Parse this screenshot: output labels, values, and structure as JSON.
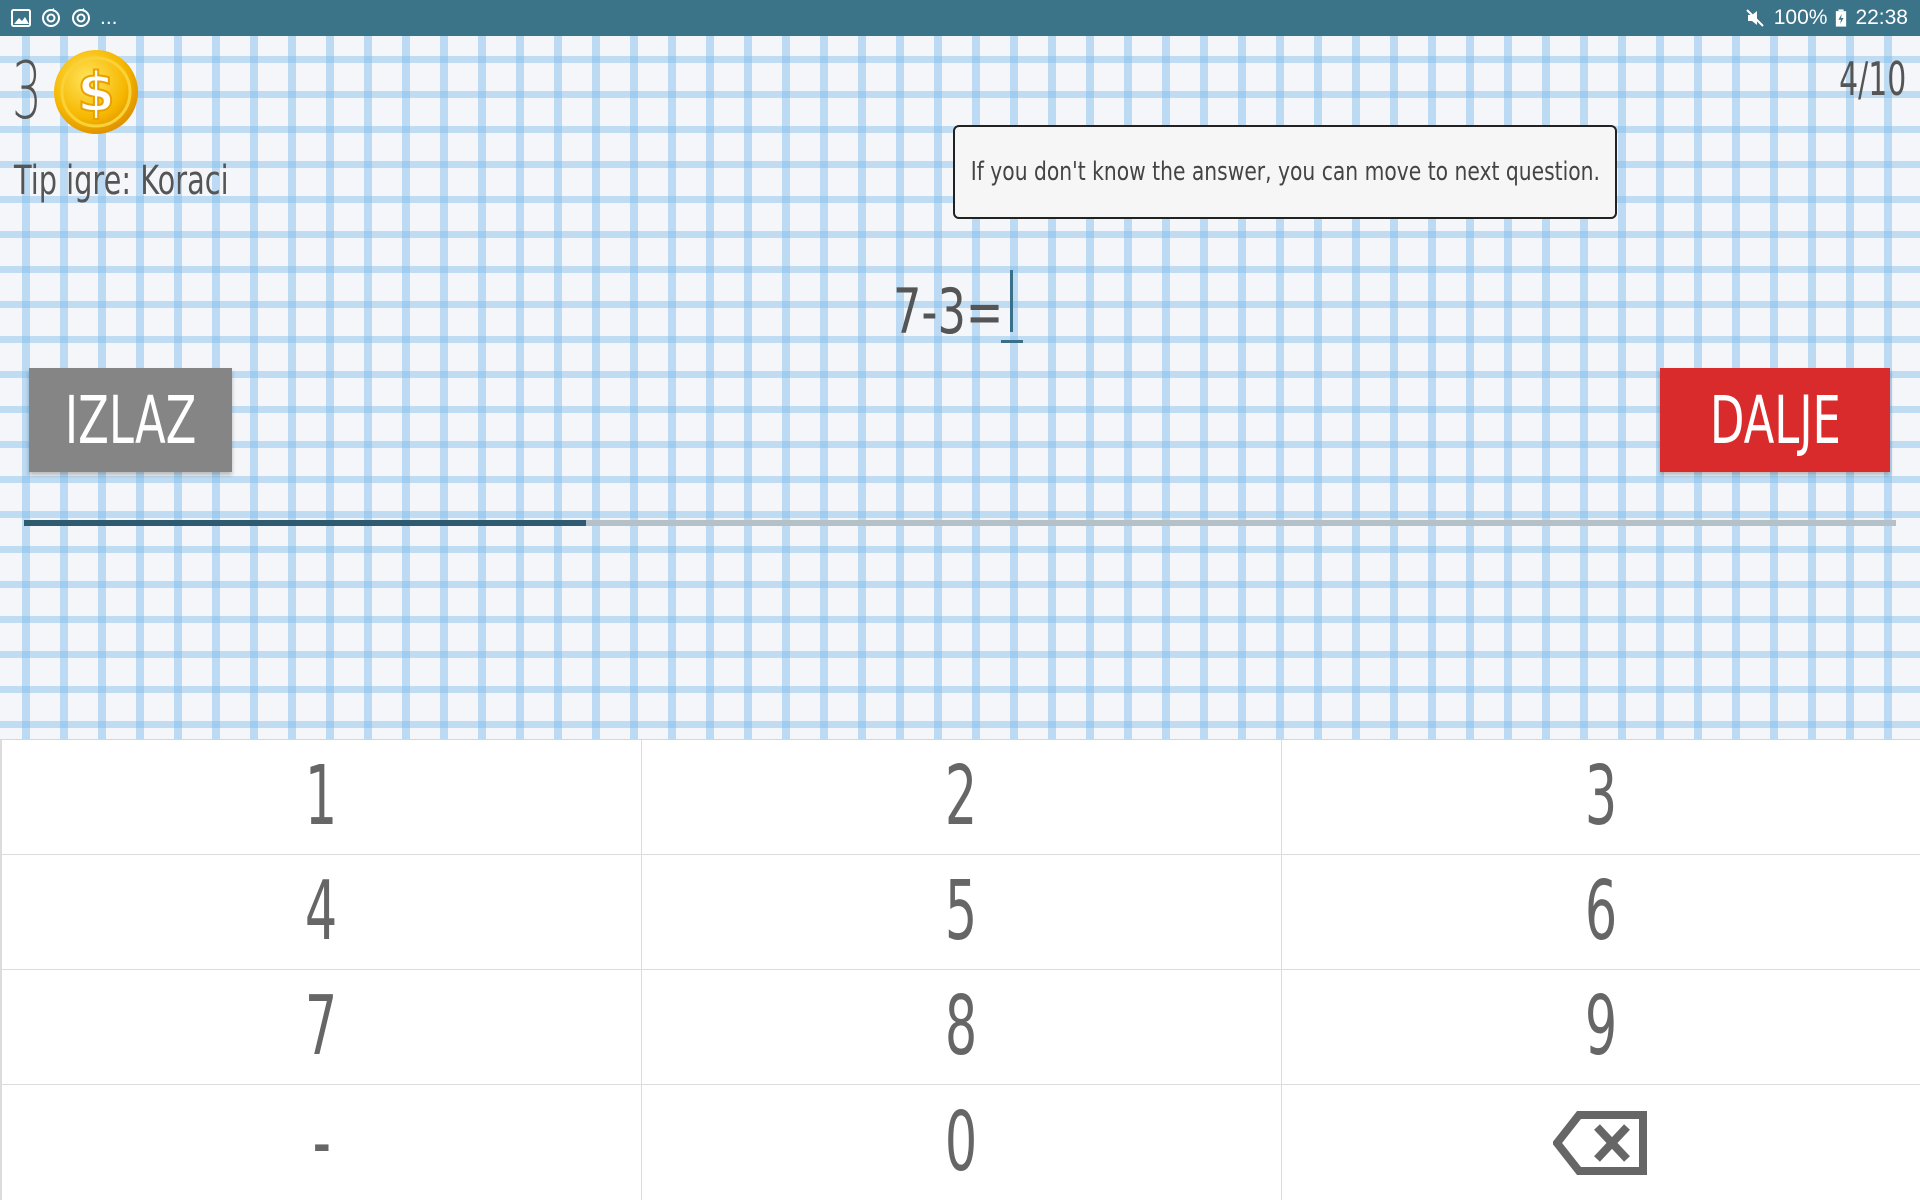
{
  "status_bar": {
    "left_icons": [
      "image-icon",
      "sync-icon",
      "sync-icon"
    ],
    "more_indicator": "...",
    "battery_percent": "100%",
    "time": "22:38",
    "colors": {
      "background": "#3b7389"
    }
  },
  "header": {
    "coin_count": "3",
    "game_type": "Tip igre: Koraci",
    "question_progress": "4/10"
  },
  "tooltip": {
    "text": "If you don't know the answer, you can move to next question."
  },
  "question": {
    "equation": "7-3=",
    "answer": ""
  },
  "buttons": {
    "exit_label": "IZLAZ",
    "next_label": "DALJE",
    "colors": {
      "exit": "#858585",
      "next": "#d92b2c"
    }
  },
  "progress": {
    "fraction": 0.3
  },
  "keypad": {
    "keys": [
      {
        "label": "1"
      },
      {
        "label": "2"
      },
      {
        "label": "3"
      },
      {
        "label": "4"
      },
      {
        "label": "5"
      },
      {
        "label": "6"
      },
      {
        "label": "7"
      },
      {
        "label": "8"
      },
      {
        "label": "9"
      },
      {
        "label": "-"
      },
      {
        "label": "0"
      },
      {
        "icon": "backspace-icon"
      }
    ]
  }
}
